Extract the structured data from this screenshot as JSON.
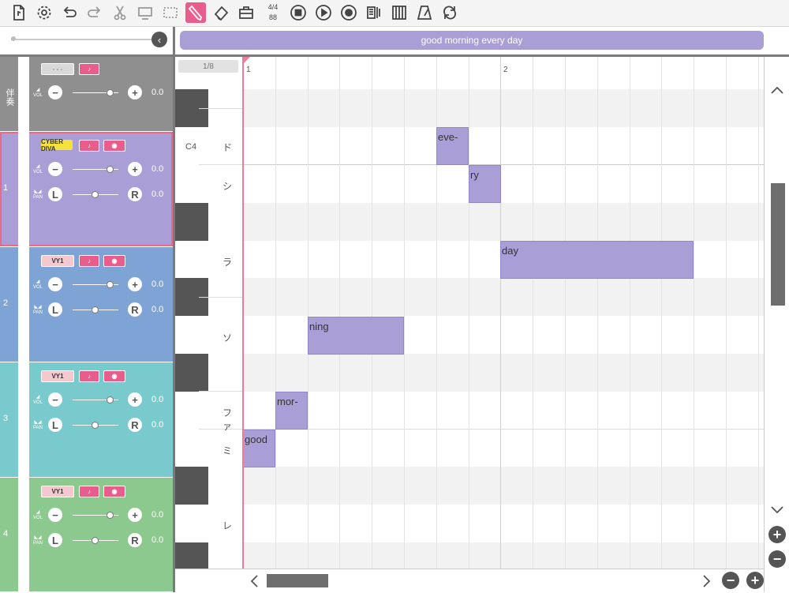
{
  "toolbar": {
    "time_signature": "4/4",
    "tempo": "88",
    "icons": [
      "new-file-icon",
      "settings-icon",
      "undo-icon",
      "redo-icon",
      "scissors-icon",
      "select-screen-icon",
      "select-dashed-icon",
      "pencil-icon",
      "eraser-icon",
      "toolbox-icon",
      "stop-icon",
      "play-icon",
      "record-icon",
      "metronome-list-icon",
      "piano-keys-icon",
      "metronome-icon",
      "loop-icon"
    ],
    "active_tool": "pencil-icon"
  },
  "lyric_bar": {
    "text": "good morning every day"
  },
  "piano_roll": {
    "division": "1/8",
    "c4_label": "C4",
    "key_names": [
      "ド",
      "シ",
      "ラ",
      "ソ",
      "ファ",
      "ミ",
      "レ"
    ],
    "bar_numbers": [
      "1",
      "2"
    ]
  },
  "tracks": [
    {
      "number": "伴奏",
      "color": "#8f8f8f",
      "tag": "- - -",
      "tag_style": "grey",
      "vol_label": "VOL",
      "vol": "0.0",
      "has_pan": false
    },
    {
      "number": "1",
      "color": "#a99fd6",
      "tag": "CYBER DIVA",
      "tag_style": "yellow",
      "vol_label": "VOL",
      "vol": "0.0",
      "pan_label": "PAN",
      "pan": "0.0",
      "has_pan": true,
      "selected": true
    },
    {
      "number": "2",
      "color": "#7ea4d6",
      "tag": "VY1",
      "tag_style": "vy",
      "vol_label": "VOL",
      "vol": "0.0",
      "pan_label": "PAN",
      "pan": "0.0",
      "has_pan": true
    },
    {
      "number": "3",
      "color": "#79cacc",
      "tag": "VY1",
      "tag_style": "vy",
      "vol_label": "VOL",
      "vol": "0.0",
      "pan_label": "PAN",
      "pan": "0.0",
      "has_pan": true
    },
    {
      "number": "4",
      "color": "#8cc98e",
      "tag": "VY1",
      "tag_style": "vy",
      "vol_label": "VOL",
      "vol": "0.0",
      "pan_label": "PAN",
      "pan": "0.0",
      "has_pan": true
    }
  ],
  "pan_left": "L",
  "pan_right": "R",
  "notes": [
    {
      "lyric": "good",
      "pitch": "E4",
      "start_step": 0,
      "length_steps": 1
    },
    {
      "lyric": "mor-",
      "pitch": "F4",
      "start_step": 1,
      "length_steps": 1
    },
    {
      "lyric": "ning",
      "pitch": "G4",
      "start_step": 2,
      "length_steps": 3
    },
    {
      "lyric": "eve-",
      "pitch": "C5",
      "start_step": 6,
      "length_steps": 1
    },
    {
      "lyric": "ry",
      "pitch": "B4",
      "start_step": 7,
      "length_steps": 1
    },
    {
      "lyric": "day",
      "pitch": "A4",
      "start_step": 8,
      "length_steps": 6
    }
  ]
}
